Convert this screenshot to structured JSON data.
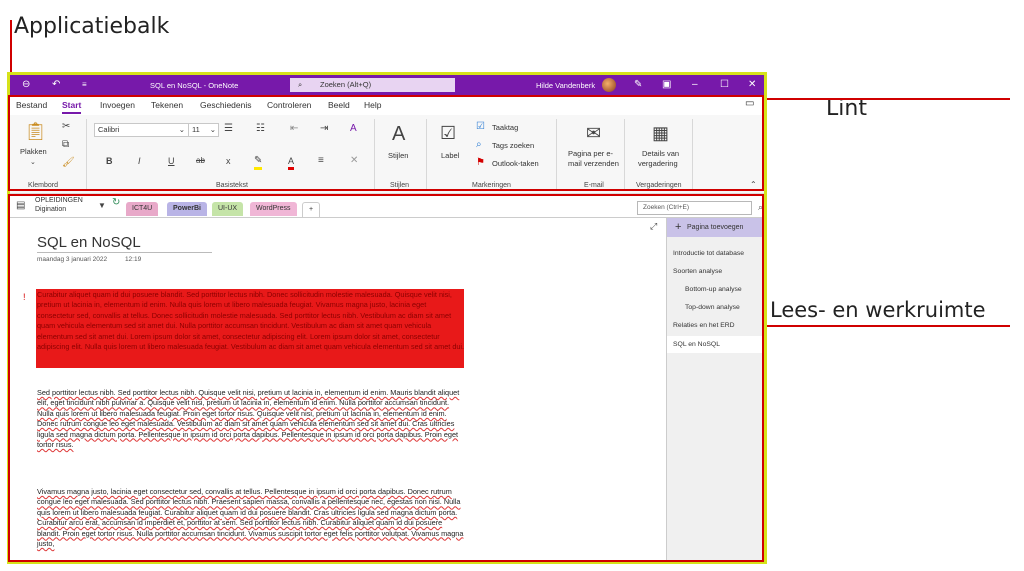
{
  "annotations": {
    "appbar": "Applicatiebalk",
    "ribbon": "Lint",
    "workspace": "Lees- en werkruimte"
  },
  "titlebar": {
    "title": "SQL en NoSQL  -  OneNote",
    "search_placeholder": "Zoeken (Alt+Q)",
    "user": "Hilde Vandenberk",
    "icons": [
      "back-arrow-icon",
      "undo-icon",
      "quick-access-dropdown-icon",
      "pen-icon",
      "ribbon-display-icon",
      "minimize-icon",
      "maximize-icon",
      "close-icon"
    ]
  },
  "menu": {
    "tabs": [
      "Bestand",
      "Start",
      "Invoegen",
      "Tekenen",
      "Geschiedenis",
      "Controleren",
      "Beeld",
      "Help"
    ],
    "active": "Start"
  },
  "ribbon": {
    "clipboard": {
      "paste": "Plakken",
      "group": "Klembord"
    },
    "basic_text": {
      "font": "Calibri",
      "size": "11",
      "bold": "B",
      "italic": "I",
      "underline": "U",
      "strike": "ab",
      "subscript": "x",
      "highlight_letter": "A",
      "group": "Basistekst"
    },
    "styles": {
      "label": "Stijlen",
      "group": "Stijlen"
    },
    "tags": {
      "label": "Label",
      "todo": "Taaktag",
      "find": "Tags zoeken",
      "outlook": "Outlook-taken",
      "group": "Markeringen"
    },
    "email": {
      "label_line1": "Pagina per e-",
      "label_line2": "mail verzenden",
      "group": "E-mail"
    },
    "meetings": {
      "label_line1": "Details van",
      "label_line2": "vergadering",
      "group": "Vergaderingen"
    }
  },
  "notebook": {
    "name_line1": "OPLEIDINGEN",
    "name_line2": "Digination",
    "sections": [
      {
        "name": "ICT4U",
        "color": "#e8a9c9"
      },
      {
        "name": "PowerBi",
        "color": "#b9b4e6"
      },
      {
        "name": "UI-UX",
        "color": "#c5e4a8"
      },
      {
        "name": "WordPress",
        "color": "#f0b6d6"
      },
      {
        "name": "+",
        "color": "#ffffff"
      }
    ],
    "active_section": "PowerBi",
    "search_placeholder": "Zoeken (Ctrl+E)"
  },
  "page": {
    "title": "SQL en NoSQL",
    "date": "maandag 3 januari 2022",
    "time": "12:19",
    "paragraph1": "Curabitur aliquet quam id dui posuere blandit. Sed porttitor lectus nibh. Donec sollicitudin molestie malesuada. Quisque velit nisi, pretium ut lacinia in, elementum id enim. Nulla quis lorem ut libero malesuada feugiat. Vivamus magna justo, lacinia eget consectetur sed, convallis at tellus. Donec sollicitudin molestie malesuada. Sed porttitor lectus nibh. Vestibulum ac diam sit amet quam vehicula elementum sed sit amet dui. Nulla porttitor accumsan tincidunt. Vestibulum ac diam sit amet quam vehicula elementum sed sit amet dui. Lorem ipsum dolor sit amet, consectetur adipiscing elit. Lorem ipsum dolor sit amet, consectetur adipiscing elit. Nulla quis lorem ut libero malesuada feugiat. Vestibulum ac diam sit amet quam vehicula elementum sed sit amet dui.",
    "paragraph2": "Sed porttitor lectus nibh. Sed porttitor lectus nibh. Quisque velit nisi, pretium ut lacinia in, elementum id enim. Mauris blandit aliquet elit, eget tincidunt nibh pulvinar a. Quisque velit nisi, pretium ut lacinia in, elementum id enim. Nulla porttitor accumsan tincidunt. Nulla quis lorem ut libero malesuada feugiat. Proin eget tortor risus. Quisque velit nisi, pretium ut lacinia in, elementum id enim. Donec rutrum congue leo eget malesuada. Vestibulum ac diam sit amet quam vehicula elementum sed sit amet dui. Cras ultricies ligula sed magna dictum porta. Pellentesque in ipsum id orci porta dapibus. Pellentesque in ipsum id orci porta dapibus. Proin eget tortor risus.",
    "paragraph3": "Vivamus magna justo, lacinia eget consectetur sed, convallis at tellus. Pellentesque in ipsum id orci porta dapibus. Donec rutrum congue leo eget malesuada. Sed porttitor lectus nibh. Praesent sapien massa, convallis a pellentesque nec, egestas non nisi. Nulla quis lorem ut libero malesuada feugiat. Curabitur aliquet quam id dui posuere blandit. Cras ultricies ligula sed magna dictum porta. Curabitur arcu erat, accumsan id imperdiet et, porttitor at sem. Sed porttitor lectus nibh. Curabitur aliquet quam id dui posuere blandit. Proin eget tortor risus. Nulla porttitor accumsan tincidunt. Vivamus suscipit tortor eget felis porttitor volutpat. Vivamus magna justo,"
  },
  "pages": {
    "add": "Pagina toevoegen",
    "items": [
      {
        "title": "Introductie tot database",
        "indent": 0
      },
      {
        "title": "Soorten analyse",
        "indent": 0
      },
      {
        "title": "Bottom-up analyse",
        "indent": 1
      },
      {
        "title": "Top-down analyse",
        "indent": 1
      },
      {
        "title": "Relaties en het ERD",
        "indent": 0
      },
      {
        "title": "SQL en NoSQL",
        "indent": 0
      }
    ],
    "selected": "SQL en NoSQL"
  },
  "colors": {
    "titlebar": "#7719aa",
    "highlight": "#e60000",
    "appbar_frame": "#d6e21a",
    "annotation_line": "#d00000"
  }
}
